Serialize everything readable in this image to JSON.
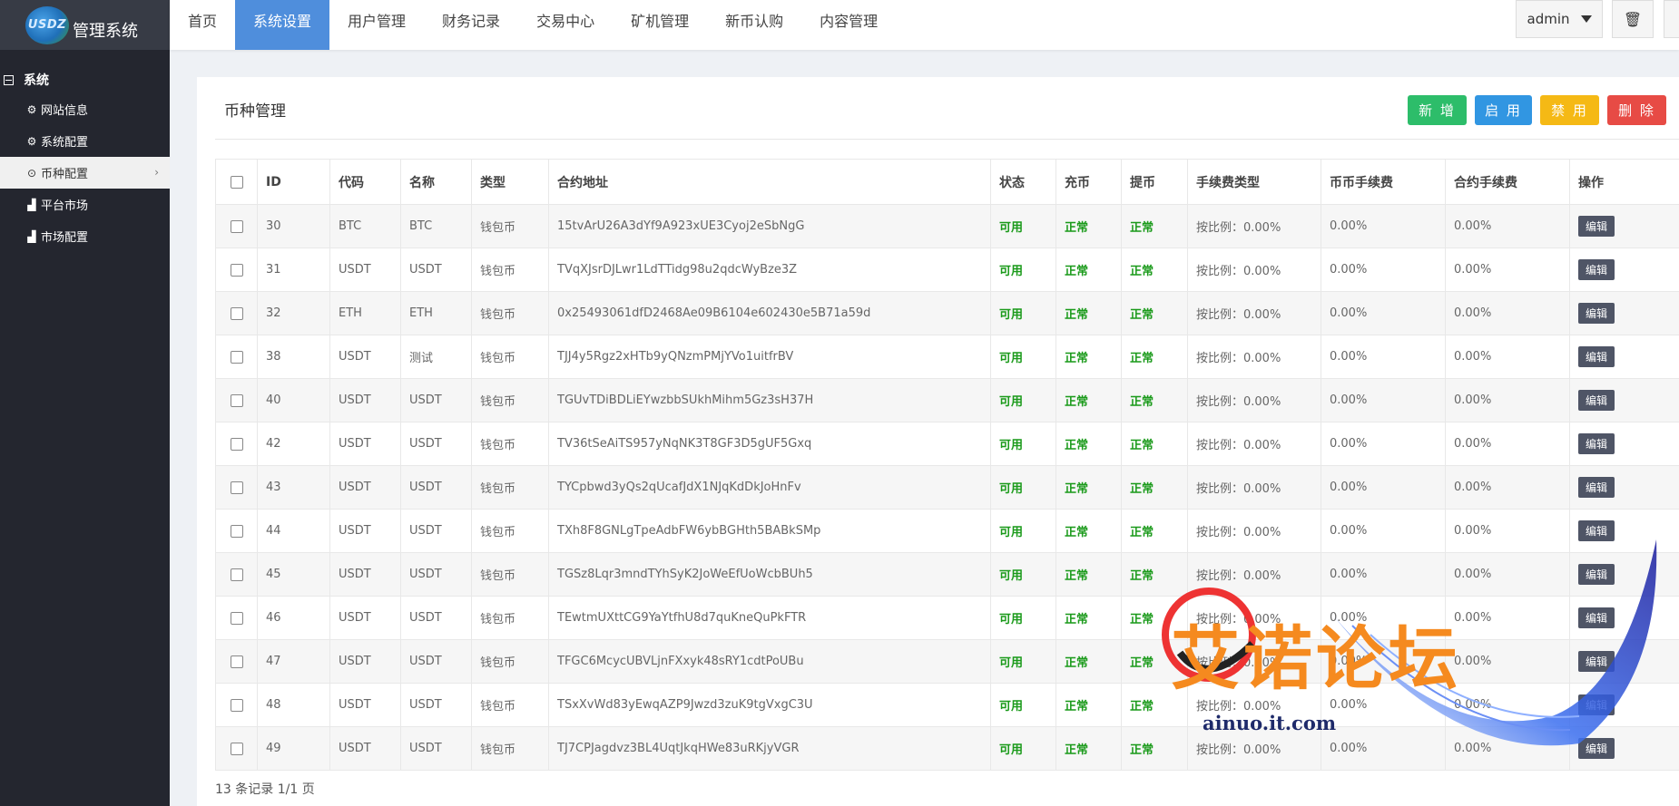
{
  "logo": {
    "mark": "USDZ",
    "title": "管理系统"
  },
  "sidebar": {
    "group": "系统",
    "items": [
      {
        "label": "网站信息",
        "icon": "gear-icon",
        "glyph": "⚙"
      },
      {
        "label": "系统配置",
        "icon": "gear-icon",
        "glyph": "⚙"
      },
      {
        "label": "币种配置",
        "icon": "circle-dot-icon",
        "glyph": "⊙",
        "active": true
      },
      {
        "label": "平台市场",
        "icon": "bar-chart-icon",
        "glyph": "▟"
      },
      {
        "label": "市场配置",
        "icon": "bar-chart-icon",
        "glyph": "▟"
      }
    ]
  },
  "nav": {
    "items": [
      "首页",
      "系统设置",
      "用户管理",
      "财务记录",
      "交易中心",
      "矿机管理",
      "新币认购",
      "内容管理"
    ],
    "active_index": 1,
    "user": "admin"
  },
  "panel": {
    "title": "币种管理",
    "buttons": {
      "add": "新 增",
      "enable": "启 用",
      "disable": "禁 用",
      "delete": "删 除"
    }
  },
  "table": {
    "headers": [
      "",
      "ID",
      "代码",
      "名称",
      "类型",
      "合约地址",
      "状态",
      "充币",
      "提币",
      "手续费类型",
      "币币手续费",
      "合约手续费",
      "操作"
    ],
    "rows": [
      [
        "30",
        "BTC",
        "BTC",
        "钱包币",
        "15tvArU26A3dYf9A923xUE3Cyoj2eSbNgG",
        "可用",
        "正常",
        "正常",
        "按比例：0.00%",
        "0.00%",
        "0.00%",
        "编辑"
      ],
      [
        "31",
        "USDT",
        "USDT",
        "钱包币",
        "TVqXJsrDJLwr1LdTTidg98u2qdcWyBze3Z",
        "可用",
        "正常",
        "正常",
        "按比例：0.00%",
        "0.00%",
        "0.00%",
        "编辑"
      ],
      [
        "32",
        "ETH",
        "ETH",
        "钱包币",
        "0x25493061dfD2468Ae09B6104e602430e5B71a59d",
        "可用",
        "正常",
        "正常",
        "按比例：0.00%",
        "0.00%",
        "0.00%",
        "编辑"
      ],
      [
        "38",
        "USDT",
        "测试",
        "钱包币",
        "TJJ4y5Rgz2xHTb9yQNzmPMjYVo1uitfrBV",
        "可用",
        "正常",
        "正常",
        "按比例：0.00%",
        "0.00%",
        "0.00%",
        "编辑"
      ],
      [
        "40",
        "USDT",
        "USDT",
        "钱包币",
        "TGUvTDiBDLiEYwzbbSUkhMihm5Gz3sH37H",
        "可用",
        "正常",
        "正常",
        "按比例：0.00%",
        "0.00%",
        "0.00%",
        "编辑"
      ],
      [
        "42",
        "USDT",
        "USDT",
        "钱包币",
        "TV36tSeAiTS957yNqNK3T8GF3D5gUF5Gxq",
        "可用",
        "正常",
        "正常",
        "按比例：0.00%",
        "0.00%",
        "0.00%",
        "编辑"
      ],
      [
        "43",
        "USDT",
        "USDT",
        "钱包币",
        "TYCpbwd3yQs2qUcafJdX1NJqKdDkJoHnFv",
        "可用",
        "正常",
        "正常",
        "按比例：0.00%",
        "0.00%",
        "0.00%",
        "编辑"
      ],
      [
        "44",
        "USDT",
        "USDT",
        "钱包币",
        "TXh8F8GNLgTpeAdbFW6ybBGHth5BABkSMp",
        "可用",
        "正常",
        "正常",
        "按比例：0.00%",
        "0.00%",
        "0.00%",
        "编辑"
      ],
      [
        "45",
        "USDT",
        "USDT",
        "钱包币",
        "TGSz8Lqr3mndTYhSyK2JoWeEfUoWcbBUh5",
        "可用",
        "正常",
        "正常",
        "按比例：0.00%",
        "0.00%",
        "0.00%",
        "编辑"
      ],
      [
        "46",
        "USDT",
        "USDT",
        "钱包币",
        "TEwtmUXttCG9YaYtfhU8d7quKneQuPkFTR",
        "可用",
        "正常",
        "正常",
        "按比例：0.00%",
        "0.00%",
        "0.00%",
        "编辑"
      ],
      [
        "47",
        "USDT",
        "USDT",
        "钱包币",
        "TFGC6McycUBVLjnFXxyk48sRY1cdtPoUBu",
        "可用",
        "正常",
        "正常",
        "按比例：0.00%",
        "0.00%",
        "0.00%",
        "编辑"
      ],
      [
        "48",
        "USDT",
        "USDT",
        "钱包币",
        "TSxXvWd83yEwqAZP9Jwzd3zuK9tgVxgC3U",
        "可用",
        "正常",
        "正常",
        "按比例：0.00%",
        "0.00%",
        "0.00%",
        "编辑"
      ],
      [
        "49",
        "USDT",
        "USDT",
        "钱包币",
        "TJ7CPJagdvz3BL4UqtJkqHWe83uRKjyVGR",
        "可用",
        "正常",
        "正常",
        "按比例：0.00%",
        "0.00%",
        "0.00%",
        "编辑"
      ]
    ]
  },
  "footer": {
    "summary": "13 条记录 1/1 页"
  },
  "watermark": {
    "text": "艾诺论坛",
    "sub": "ainuo.it.com"
  },
  "colors": {
    "sidebar": "#24262f",
    "nav_active": "#4f8edc",
    "green": "#2dbd6a",
    "blue": "#3196e2",
    "yellow": "#f5b915",
    "red": "#e74b45",
    "ok": "#1a9a1a"
  }
}
